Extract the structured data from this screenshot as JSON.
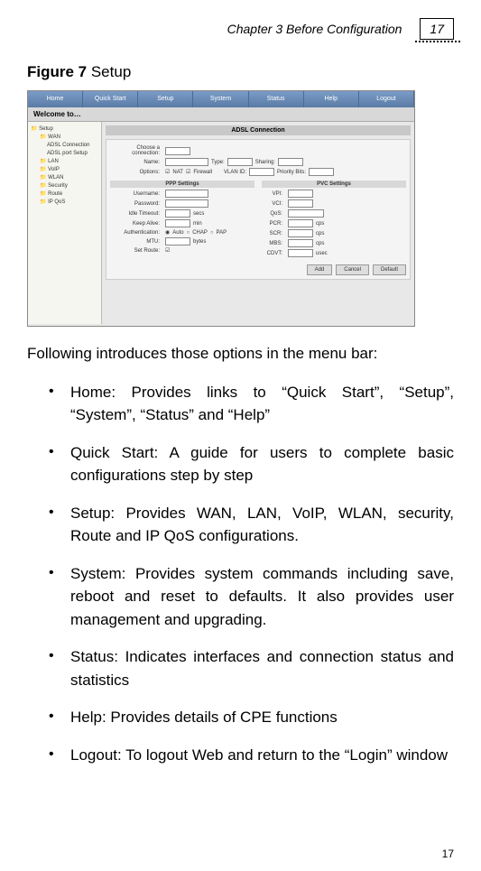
{
  "header": {
    "chapter": "Chapter 3 Before Configuration",
    "page": "17"
  },
  "figure": {
    "label_bold": "Figure 7",
    "label_rest": " Setup"
  },
  "screenshot": {
    "tabs": [
      "Home",
      "Quick Start",
      "Setup",
      "System",
      "Status",
      "Help",
      "Logout"
    ],
    "welcome": "Welcome to…",
    "tree": [
      "Setup",
      "WAN",
      "ADSL Connection",
      "ADSL port Setup",
      "LAN",
      "VoIP",
      "WLAN",
      "Security",
      "Route",
      "IP QoS"
    ],
    "panel_title": "ADSL Connection",
    "choose_label": "Choose a connection:",
    "fields": {
      "name_lbl": "Name:",
      "type_lbl": "Type:",
      "sharing_lbl": "Sharing:",
      "options_lbl": "Options:",
      "nat": "NAT",
      "firewall": "Firewall",
      "vlanid_lbl": "VLAN ID:",
      "priority_lbl": "Priority Bits:",
      "ppp_head": "PPP Settings",
      "pvc_head": "PVC Settings",
      "username_lbl": "Username:",
      "password_lbl": "Password:",
      "idle_lbl": "Idle Timeout:",
      "secs": "secs",
      "keep_lbl": "Keep Alive:",
      "min": "min",
      "auth_lbl": "Authentication:",
      "auto": "Auto",
      "chap": "CHAP",
      "pap": "PAP",
      "mtu_lbl": "MTU:",
      "bytes": "bytes",
      "default_lbl": "Set Route:",
      "vpi_lbl": "VPI:",
      "vci_lbl": "VCI:",
      "qos_lbl": "QoS:",
      "pcr_lbl": "PCR:",
      "scr_lbl": "SCR:",
      "mbs_lbl": "MBS:",
      "cdvt_lbl": "CDVT:",
      "cps": "cps",
      "usec": "usec"
    },
    "buttons": {
      "add": "Add",
      "cancel": "Cancel",
      "default": "Default"
    }
  },
  "intro": "Following introduces those options in the menu bar:",
  "bullets": [
    "Home: Provides links to “Quick Start”, “Setup”, “System”, “Status” and “Help”",
    "Quick Start: A guide for users to complete basic configurations step by step",
    "Setup: Provides WAN, LAN, VoIP, WLAN, security, Route and IP QoS configurations.",
    "System: Provides system commands including save, reboot and reset to defaults. It also provides user management and upgrading.",
    "Status: Indicates interfaces and connection status and statistics",
    "Help: Provides details of CPE functions",
    "Logout: To logout Web and return to the “Login” window"
  ],
  "footer_page": "17"
}
